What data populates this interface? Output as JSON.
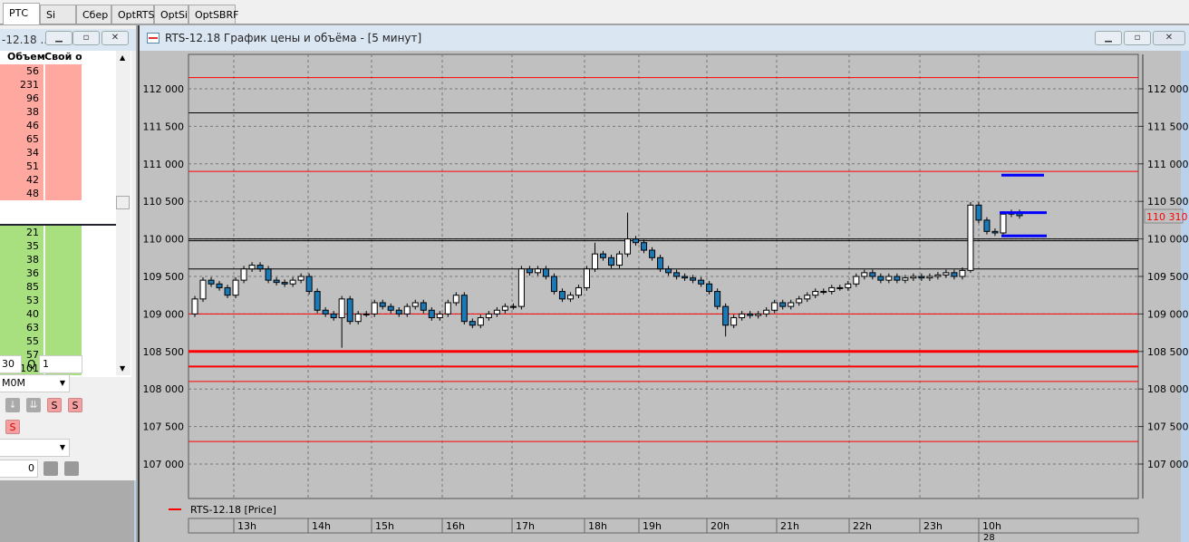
{
  "tabs": [
    {
      "label": "РТС",
      "active": true
    },
    {
      "label": "Si"
    },
    {
      "label": "Сбер"
    },
    {
      "label": "OptRTS"
    },
    {
      "label": "OptSi"
    },
    {
      "label": "OptSBRF"
    }
  ],
  "left_panel": {
    "title": "-12.18 ...",
    "columns": [
      "Объем",
      "Свой об"
    ],
    "asks": [
      "56",
      "231",
      "96",
      "38",
      "46",
      "65",
      "34",
      "51",
      "42",
      "48"
    ],
    "bids": [
      "21",
      "35",
      "38",
      "36",
      "85",
      "53",
      "40",
      "63",
      "55",
      "57",
      "101"
    ],
    "price_input": "30",
    "q_label": "Q",
    "q_input": "1",
    "account_select": "M0M",
    "account_select2": "",
    "amount_input": "0",
    "colors": {
      "ask": "#ffa8a0",
      "bid": "#a8e080"
    }
  },
  "chart_window": {
    "title": "RTS-12.18 График цены и объёма - [5 минут]",
    "legend": "RTS-12.18 [Price]",
    "current_price_label": "110 310",
    "date_label": "28"
  },
  "chart_data": {
    "type": "candlestick",
    "series_name": "RTS-12.18 [Price]",
    "y_ticks": [
      112000,
      111500,
      111000,
      110500,
      110000,
      109500,
      109000,
      108500,
      108000,
      107500,
      107000
    ],
    "y_tick_labels": [
      "112 000",
      "111 500",
      "111 000",
      "110 500",
      "110 000",
      "109 500",
      "109 000",
      "108 500",
      "108 000",
      "107 500",
      "107 000"
    ],
    "ylim": [
      106830,
      112300
    ],
    "x_labels": [
      "13h",
      "14h",
      "15h",
      "16h",
      "17h",
      "18h",
      "19h",
      "20h",
      "21h",
      "22h",
      "23h",
      "10h"
    ],
    "close": [
      109200,
      109450,
      109400,
      109350,
      109250,
      109450,
      109600,
      109650,
      109600,
      109450,
      109420,
      109400,
      109450,
      109500,
      109300,
      109050,
      109000,
      108950,
      109200,
      108900,
      109000,
      109000,
      109150,
      109100,
      109050,
      109000,
      109100,
      109150,
      109050,
      108950,
      109000,
      109150,
      109250,
      108900,
      108850,
      108950,
      109000,
      109050,
      109100,
      109100,
      109600,
      109550,
      109600,
      109500,
      109300,
      109200,
      109250,
      109350,
      109600,
      109800,
      109750,
      109650,
      109800,
      110000,
      109950,
      109850,
      109750,
      109600,
      109550,
      109500,
      109480,
      109450,
      109400,
      109300,
      109100,
      108850,
      108950,
      109000,
      108980,
      109000,
      109050,
      109150,
      109100,
      109150,
      109200,
      109250,
      109300,
      109300,
      109350,
      109350,
      109400,
      109500,
      109550,
      109500,
      109450,
      109500,
      109450,
      109480,
      109500,
      109480,
      109500,
      109520,
      109550,
      109500,
      109580,
      110450,
      110250,
      110100,
      110080,
      110330,
      110350,
      110310
    ],
    "first_open": 109000,
    "extremes": [
      {
        "i": 18,
        "low": 108550
      },
      {
        "i": 53,
        "high": 110350
      },
      {
        "i": 65,
        "low": 108700
      },
      {
        "i": 49,
        "high": 109950
      },
      {
        "i": 95,
        "low": 109550
      }
    ],
    "levels": [
      {
        "price": 112150,
        "color": "#ff0000",
        "w": 1
      },
      {
        "price": 111680,
        "color": "#000000",
        "w": 1
      },
      {
        "price": 110900,
        "color": "#ff0000",
        "w": 1
      },
      {
        "price": 110000,
        "color": "#000000",
        "w": 1
      },
      {
        "price": 109975,
        "color": "#000000",
        "w": 1
      },
      {
        "price": 109600,
        "color": "#000000",
        "w": 1
      },
      {
        "price": 109000,
        "color": "#ff0000",
        "w": 1
      },
      {
        "price": 108500,
        "color": "#ff0000",
        "w": 3
      },
      {
        "price": 108300,
        "color": "#ff0000",
        "w": 2
      },
      {
        "price": 108100,
        "color": "#ff0000",
        "w": 1
      },
      {
        "price": 107300,
        "color": "#ff0000",
        "w": 1
      }
    ],
    "drawn_lines": [
      {
        "price": 110850,
        "color": "#0000ff"
      },
      {
        "price": 110350,
        "color": "#0000ff"
      },
      {
        "price": 110040,
        "color": "#0000ff"
      }
    ],
    "colors": {
      "up": "#ffffff",
      "down": "#1a7ab8",
      "bg": "#c0c0c0"
    }
  }
}
